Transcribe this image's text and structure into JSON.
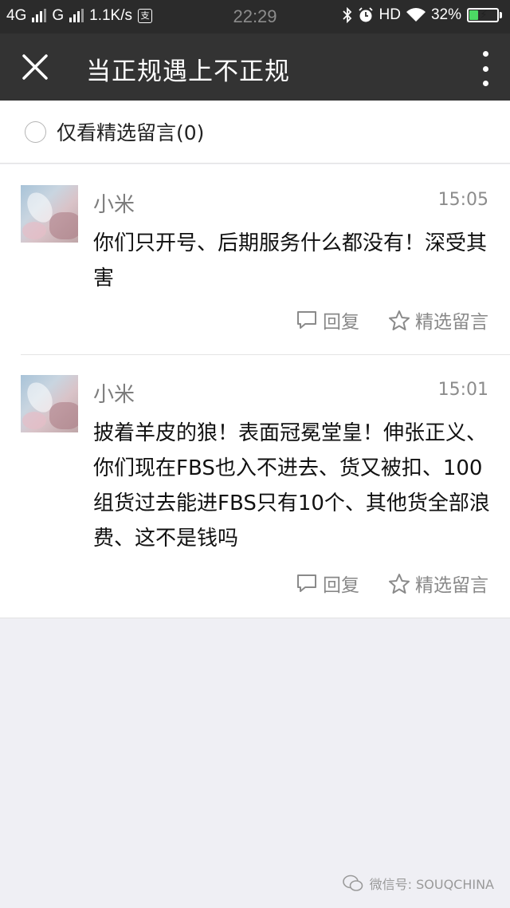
{
  "status_bar": {
    "network_1": "4G",
    "network_2": "G",
    "speed": "1.1K/s",
    "pay_icon_text": "支",
    "time": "22:29",
    "hd": "HD",
    "battery": "32%"
  },
  "nav": {
    "title": "当正规遇上不正规"
  },
  "filter": {
    "label": "仅看精选留言(0)"
  },
  "comments": [
    {
      "nickname": "小米",
      "time": "15:05",
      "text": "你们只开号、后期服务什么都没有！深受其害",
      "reply_label": "回复",
      "feature_label": "精选留言"
    },
    {
      "nickname": "小米",
      "time": "15:01",
      "text": "披着羊皮的狼！表面冠冕堂皇！伸张正义、你们现在FBS也入不进去、货又被扣、100组货过去能进FBS只有10个、其他货全部浪费、这不是钱吗",
      "reply_label": "回复",
      "feature_label": "精选留言"
    }
  ],
  "watermark": {
    "text": "微信号: SOUQCHINA"
  },
  "colors": {
    "status_bar_bg": "#2b2b2b",
    "nav_bg": "#333333",
    "page_bg": "#efeff4",
    "battery_green": "#4cd964"
  }
}
